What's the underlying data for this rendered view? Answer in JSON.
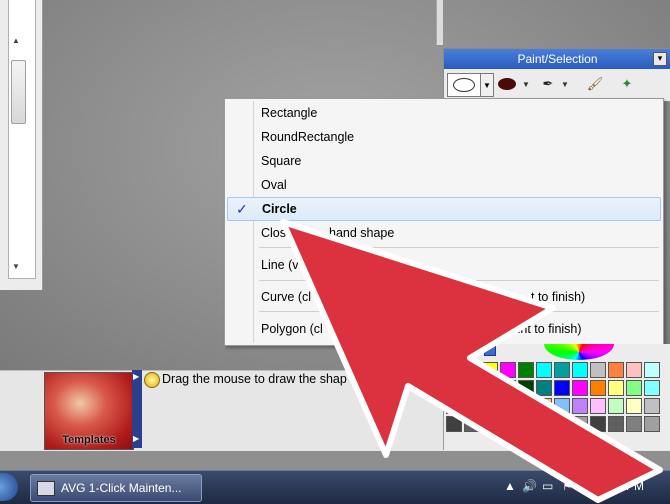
{
  "paint_panel": {
    "title": "Paint/Selection",
    "close_glyph": "▾"
  },
  "shape_menu": {
    "items": [
      {
        "label": "Rectangle",
        "checked": false
      },
      {
        "label": "RoundRectangle",
        "checked": false
      },
      {
        "label": "Square",
        "checked": false
      },
      {
        "label": "Oval",
        "checked": false
      },
      {
        "label": "Circle",
        "checked": true
      },
      {
        "label": "Clos",
        "checked": false
      },
      {
        "label": "hand shape",
        "checked": false
      },
      {
        "label": "Line (v",
        "checked": false
      },
      {
        "label": "Curve  (cl",
        "checked": false
      },
      {
        "label": "t to finish)",
        "checked": false
      },
      {
        "label": "Polygon (cl",
        "checked": false
      },
      {
        "label": "t the last point to finish)",
        "checked": false
      }
    ],
    "check_glyph": "✓"
  },
  "bottom": {
    "templates_label": "Templates",
    "hint_text": "Drag the mouse to draw the shap"
  },
  "palette": {
    "colors": [
      "#ffffff",
      "#ff0000",
      "#ffff00",
      "#ff00ff",
      "#008000",
      "#00ffff",
      "#00a0a0",
      "#00ffff",
      "#c0c0c0",
      "#ff8040",
      "#ffc0c0",
      "#c0ffff",
      "#808080",
      "#800000",
      "#808000",
      "#800080",
      "#004000",
      "#008080",
      "#0000ff",
      "#ff00ff",
      "#ff8000",
      "#ffff80",
      "#80ff80",
      "#80ffff",
      "#804000",
      "#ff8080",
      "#ffff00",
      "#ff80ff",
      "#c0c0ff",
      "#ffc080",
      "#80c0ff",
      "#c080ff",
      "#ffc0ff",
      "#c0ffc0",
      "#ffffc0",
      "#c0c0c0",
      "#404040",
      "#606060",
      "#808080",
      "#a0a0a0",
      "#404040",
      "#606060",
      "#808080",
      "#a0a0a0",
      "#404040",
      "#606060",
      "#808080",
      "#a0a0a0"
    ]
  },
  "taskbar": {
    "task_label": "AVG 1-Click Mainten...",
    "tray_text": "PM"
  },
  "overlay": {
    "arrow_color": "#dc3240"
  }
}
